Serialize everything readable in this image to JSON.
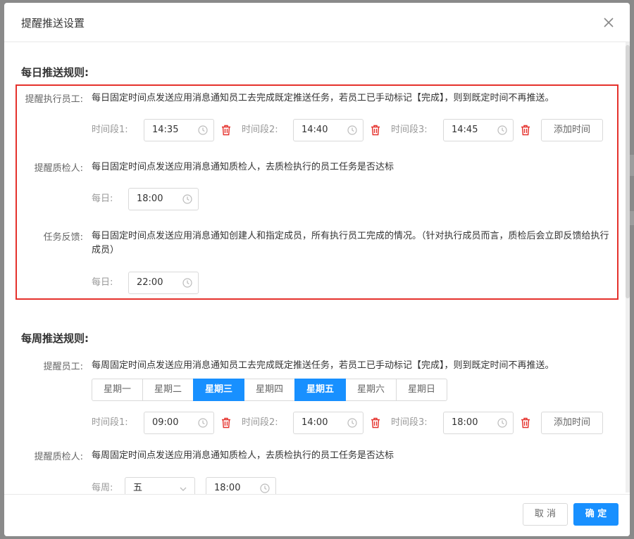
{
  "dialog": {
    "title": "提醒推送设置",
    "close_icon": "close-icon"
  },
  "daily": {
    "title": "每日推送规则:",
    "executor": {
      "label": "提醒执行员工:",
      "desc": "每日固定时间点发送应用消息通知员工去完成既定推送任务，若员工已手动标记【完成】，则到既定时间不再推送。",
      "slots": [
        {
          "label": "时间段1:",
          "value": "14:35"
        },
        {
          "label": "时间段2:",
          "value": "14:40"
        },
        {
          "label": "时间段3:",
          "value": "14:45"
        }
      ],
      "add_label": "添加时间"
    },
    "inspector": {
      "label": "提醒质检人:",
      "desc": "每日固定时间点发送应用消息通知质检人，去质检执行的员工任务是否达标",
      "time_label": "每日:",
      "time_value": "18:00"
    },
    "feedback": {
      "label": "任务反馈:",
      "desc": "每日固定时间点发送应用消息通知创建人和指定成员，所有执行员工完成的情况。（针对执行成员而言，质检后会立即反馈给执行成员）",
      "time_label": "每日:",
      "time_value": "22:00"
    }
  },
  "weekly": {
    "title": "每周推送规则:",
    "employee": {
      "label": "提醒员工:",
      "desc": "每周固定时间点发送应用消息通知员工去完成既定推送任务，若员工已手动标记【完成】，则到既定时间不再推送。",
      "days": [
        {
          "label": "星期一",
          "active": false
        },
        {
          "label": "星期二",
          "active": false
        },
        {
          "label": "星期三",
          "active": true
        },
        {
          "label": "星期四",
          "active": false
        },
        {
          "label": "星期五",
          "active": true
        },
        {
          "label": "星期六",
          "active": false
        },
        {
          "label": "星期日",
          "active": false
        }
      ],
      "slots": [
        {
          "label": "时间段1:",
          "value": "09:00"
        },
        {
          "label": "时间段2:",
          "value": "14:00"
        },
        {
          "label": "时间段3:",
          "value": "18:00"
        }
      ],
      "add_label": "添加时间"
    },
    "inspector": {
      "label": "提醒质检人:",
      "desc": "每周固定时间点发送应用消息通知质检人，去质检执行的员工任务是否达标",
      "time_label": "每周:",
      "day_value": "五",
      "time_value": "18:00"
    }
  },
  "footer": {
    "cancel_label": "取 消",
    "ok_label": "确 定"
  },
  "colors": {
    "primary": "#1890ff",
    "danger": "#e5312c"
  }
}
